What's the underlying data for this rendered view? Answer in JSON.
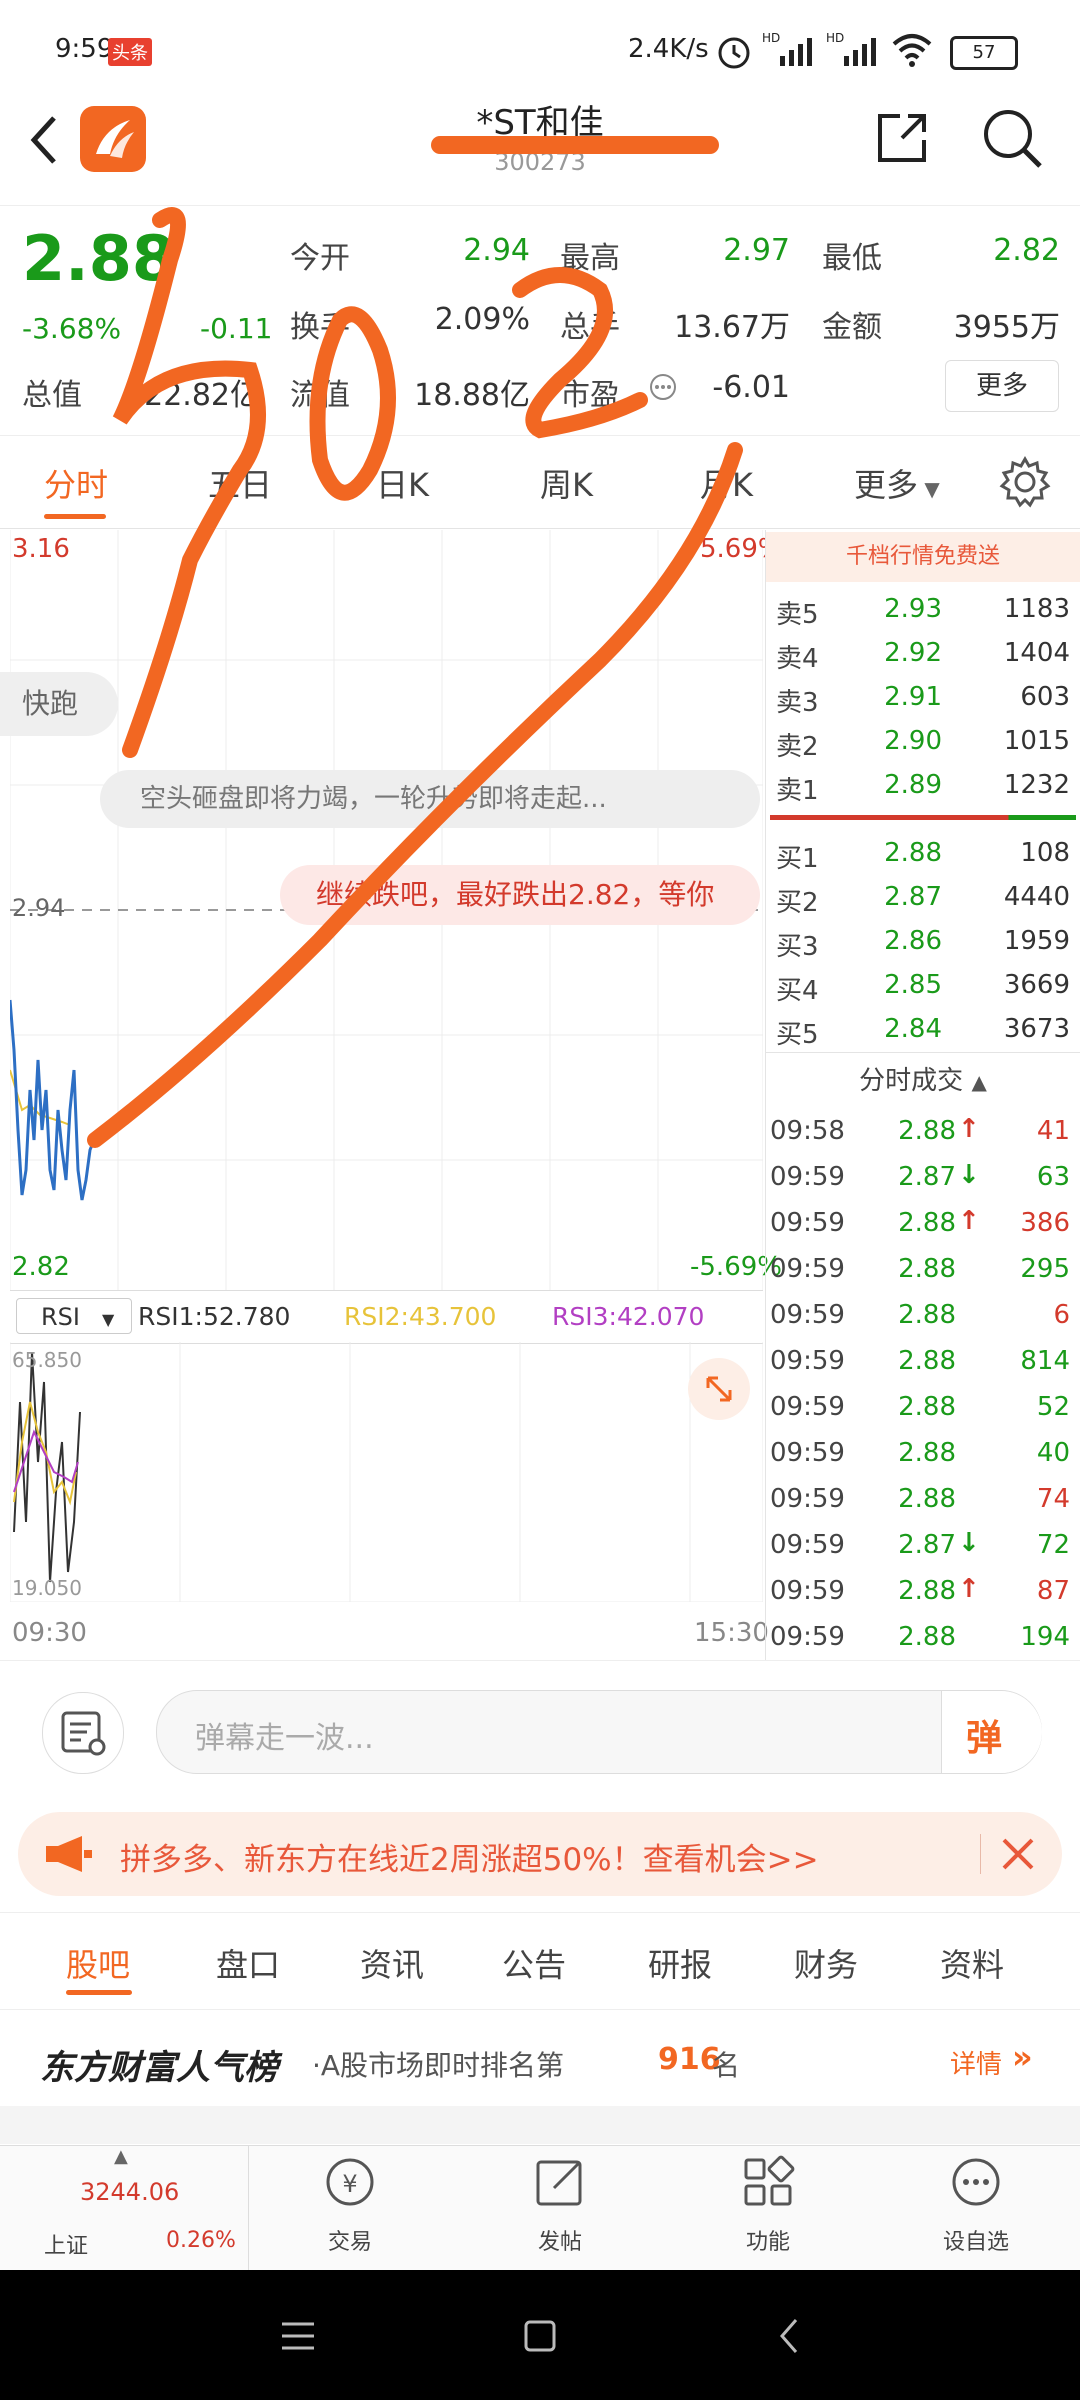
{
  "status_bar": {
    "time": "9:59",
    "app_badge": "头条",
    "net_speed": "2.4K/s",
    "battery": "57"
  },
  "header": {
    "title": "*ST和佳",
    "code": "300273"
  },
  "quote": {
    "price": "2.88",
    "change_pct": "-3.68%",
    "change_amt": "-0.11",
    "open_label": "今开",
    "open": "2.94",
    "high_label": "最高",
    "high": "2.97",
    "low_label": "最低",
    "low": "2.82",
    "turnover_label": "换手",
    "turnover": "2.09%",
    "volume_label": "总手",
    "volume": "13.67万",
    "amount_label": "金额",
    "amount": "3955万",
    "mktcap_label": "总值",
    "mktcap": "22.82亿",
    "float_label": "流值",
    "float": "18.88亿",
    "pe_label": "市盈",
    "pe": "-6.01",
    "more_button": "更多"
  },
  "tabs": [
    "分时",
    "五日",
    "日K",
    "周K",
    "月K",
    "更多"
  ],
  "chart": {
    "top_price": "3.16",
    "top_pct": "5.69%",
    "ref_price": "2.94",
    "bottom_price": "2.82",
    "bottom_pct": "-5.69%",
    "time_start": "09:30",
    "time_end": "15:30",
    "rsi_select": "RSI",
    "rsi1": "RSI1:52.780",
    "rsi2": "RSI2:43.700",
    "rsi3": "RSI3:42.070",
    "rsi_top": "65.850",
    "rsi_bottom": "19.050"
  },
  "barrage": {
    "quick_run": "快跑",
    "msg1": "空头砸盘即将力竭，一轮升势即将走起...",
    "msg2": "继续跌吧，最好跌出2.82，等你"
  },
  "order_book": {
    "banner": "千档行情免费送",
    "asks": [
      {
        "label": "卖5",
        "price": "2.93",
        "vol": "1183"
      },
      {
        "label": "卖4",
        "price": "2.92",
        "vol": "1404"
      },
      {
        "label": "卖3",
        "price": "2.91",
        "vol": "603"
      },
      {
        "label": "卖2",
        "price": "2.90",
        "vol": "1015"
      },
      {
        "label": "卖1",
        "price": "2.89",
        "vol": "1232"
      }
    ],
    "bids": [
      {
        "label": "买1",
        "price": "2.88",
        "vol": "108"
      },
      {
        "label": "买2",
        "price": "2.87",
        "vol": "4440"
      },
      {
        "label": "买3",
        "price": "2.86",
        "vol": "1959"
      },
      {
        "label": "买4",
        "price": "2.85",
        "vol": "3669"
      },
      {
        "label": "买5",
        "price": "2.84",
        "vol": "3673"
      }
    ],
    "trades_title": "分时成交",
    "trades": [
      {
        "time": "09:58",
        "price": "2.88",
        "dir": "↑",
        "vol": "41",
        "vcolor": "red"
      },
      {
        "time": "09:59",
        "price": "2.87",
        "dir": "↓",
        "vol": "63",
        "vcolor": "green"
      },
      {
        "time": "09:59",
        "price": "2.88",
        "dir": "↑",
        "vol": "386",
        "vcolor": "red"
      },
      {
        "time": "09:59",
        "price": "2.88",
        "dir": "",
        "vol": "295",
        "vcolor": "green"
      },
      {
        "time": "09:59",
        "price": "2.88",
        "dir": "",
        "vol": "6",
        "vcolor": "red"
      },
      {
        "time": "09:59",
        "price": "2.88",
        "dir": "",
        "vol": "814",
        "vcolor": "green"
      },
      {
        "time": "09:59",
        "price": "2.88",
        "dir": "",
        "vol": "52",
        "vcolor": "green"
      },
      {
        "time": "09:59",
        "price": "2.88",
        "dir": "",
        "vol": "40",
        "vcolor": "green"
      },
      {
        "time": "09:59",
        "price": "2.88",
        "dir": "",
        "vol": "74",
        "vcolor": "red"
      },
      {
        "time": "09:59",
        "price": "2.87",
        "dir": "↓",
        "vol": "72",
        "vcolor": "green"
      },
      {
        "time": "09:59",
        "price": "2.88",
        "dir": "↑",
        "vol": "87",
        "vcolor": "red"
      },
      {
        "time": "09:59",
        "price": "2.88",
        "dir": "",
        "vol": "194",
        "vcolor": "green"
      }
    ]
  },
  "input": {
    "placeholder": "弹幕走一波...",
    "send_label": "弹"
  },
  "promo": {
    "text": "拼多多、新东方在线近2周涨超50%！查看机会>>"
  },
  "bottom_tabs": [
    "股吧",
    "盘口",
    "资讯",
    "公告",
    "研报",
    "财务",
    "资料"
  ],
  "rank": {
    "brand": "东方财富人气榜",
    "prefix": "·A股市场即时排名第",
    "rank": "916",
    "suffix": "名",
    "details": "详情"
  },
  "nav": {
    "index_value": "3244.06",
    "index_name": "上证",
    "index_pct": "0.26%",
    "trade": "交易",
    "post": "发帖",
    "functions": "功能",
    "watchlist": "设自选"
  },
  "colors": {
    "accent": "#f26722",
    "up": "#d33a2c",
    "down": "#1a9a1a",
    "line": "#2d6fc4",
    "avg": "#e7c33a"
  }
}
